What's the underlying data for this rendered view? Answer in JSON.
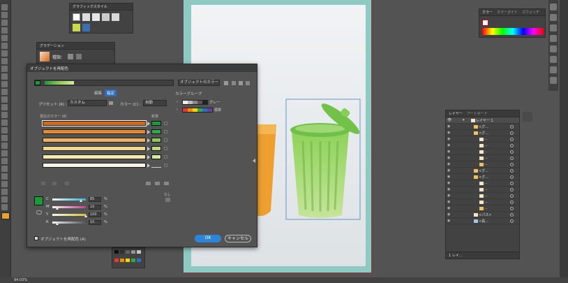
{
  "graphic_styles_panel": {
    "title": "グラフィックスタイル"
  },
  "gradient_panel": {
    "title": "グラデーション",
    "type_label": "種類："
  },
  "color_panel": {
    "tabs": [
      "カラー",
      "カラーガイド",
      "スウォッチ"
    ]
  },
  "layers_panel": {
    "tabs": [
      "レイヤー",
      "アートボード"
    ],
    "top_layer": "レイヤー 1",
    "rows": [
      {
        "label": "<グ...",
        "indent": 1,
        "thumb": "#f0c060"
      },
      {
        "label": "<グ...",
        "indent": 1,
        "thumb": "#f0c060"
      },
      {
        "label": "...",
        "indent": 2,
        "thumb": "#f3e4c8"
      },
      {
        "label": "...",
        "indent": 2,
        "thumb": "#f3e4c8"
      },
      {
        "label": "...",
        "indent": 2,
        "thumb": "#f3e4c8"
      },
      {
        "label": "...",
        "indent": 2,
        "thumb": "#f3e4c8"
      },
      {
        "label": "...",
        "indent": 2,
        "thumb": "#f0c060"
      },
      {
        "label": "<グ...",
        "indent": 1,
        "thumb": "#f0c060"
      },
      {
        "label": "<グ...",
        "indent": 1,
        "thumb": "#f0c060"
      },
      {
        "label": "...",
        "indent": 2,
        "thumb": "#f3e4c8"
      },
      {
        "label": "...",
        "indent": 2,
        "thumb": "#f3e4c8"
      },
      {
        "label": "...",
        "indent": 2,
        "thumb": "#f3e4c8"
      },
      {
        "label": "...",
        "indent": 2,
        "thumb": "#f3e4c8"
      },
      {
        "label": "...",
        "indent": 2,
        "thumb": "#f0c060"
      },
      {
        "label": "<パス>",
        "indent": 1,
        "thumb": "#f3e4c8"
      },
      {
        "label": "<長...",
        "indent": 1,
        "thumb": "#9fc8e6"
      }
    ],
    "footer": "1 レイ..."
  },
  "dialog": {
    "title": "オブジェクトを再配色",
    "objects_color_label": "オブジェクトのカラー",
    "color_groups_label": "カラーグループ",
    "groups": [
      {
        "name": "グレー",
        "colors": [
          "#eeeeee",
          "#bbbbbb",
          "#888888",
          "#555555",
          "#222222"
        ]
      },
      {
        "name": "標準",
        "colors": [
          "#e53935",
          "#f08c00",
          "#f6d400",
          "#3aa648",
          "#2b72c7",
          "#6a3fa0"
        ]
      }
    ],
    "tab_edit": "編集",
    "tab_assign": "指定",
    "preset_label": "プリセット (R) :",
    "preset_value": "カスタム",
    "colors_label": "カラー (C) :",
    "colors_value": "自動",
    "current_colors_label": "現在のカラー (8)",
    "new_label": "新規",
    "rows": [
      {
        "current": "#d2691e",
        "new": "#1a9a3a",
        "selected": true
      },
      {
        "current": "#e2892e",
        "new": "#2fa84a",
        "selected": false
      },
      {
        "current": "#ebb15e",
        "new": "#8fc855",
        "selected": false
      },
      {
        "current": "#f4d58c",
        "new": "#b9dc78",
        "selected": false
      },
      {
        "current": "#f7e7b0",
        "new": "#d8ea9c",
        "selected": false
      },
      {
        "current": "#f7f3e6",
        "new": "",
        "selected": false
      }
    ],
    "none_label": "なし",
    "sliders": [
      {
        "name": "C",
        "value": "85",
        "unit": "%",
        "level": 0.85,
        "color": "#2bb5d4"
      },
      {
        "name": "M",
        "value": "10",
        "unit": "%",
        "level": 0.1,
        "color": "#cc3b8c"
      },
      {
        "name": "Y",
        "value": "100",
        "unit": "%",
        "level": 1.0,
        "color": "#d8c52a"
      },
      {
        "name": "K",
        "value": "10",
        "unit": "%",
        "level": 0.1,
        "color": "#555555"
      }
    ],
    "checkbox_label": "オブジェクトを再配色 (A)",
    "ok_label": "OK",
    "cancel_label": "キャンセル"
  },
  "status_bar": {
    "zoom": "94.03%"
  }
}
